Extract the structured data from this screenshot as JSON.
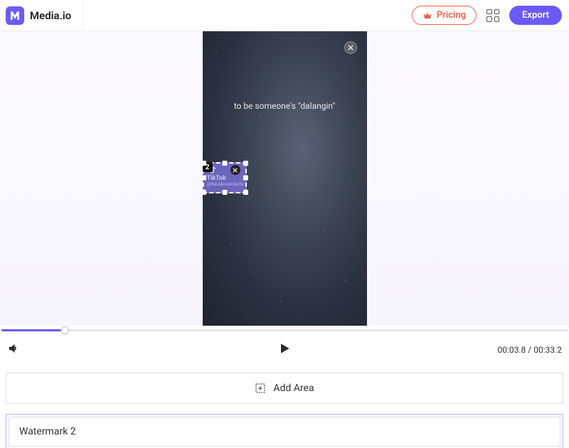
{
  "header": {
    "brand": "Media.io",
    "pricing_label": "Pricing",
    "export_label": "Export"
  },
  "video": {
    "caption": "to be someone's \"dalangin\""
  },
  "selection": {
    "badge": "2",
    "watermark_label": "TikTok",
    "watermark_sub": "@theunknownfacts"
  },
  "playback": {
    "current_time": "00:03.8",
    "total_time": "00:33.2"
  },
  "actions": {
    "add_area_label": "Add Area"
  },
  "panel": {
    "title": "Watermark 2"
  }
}
